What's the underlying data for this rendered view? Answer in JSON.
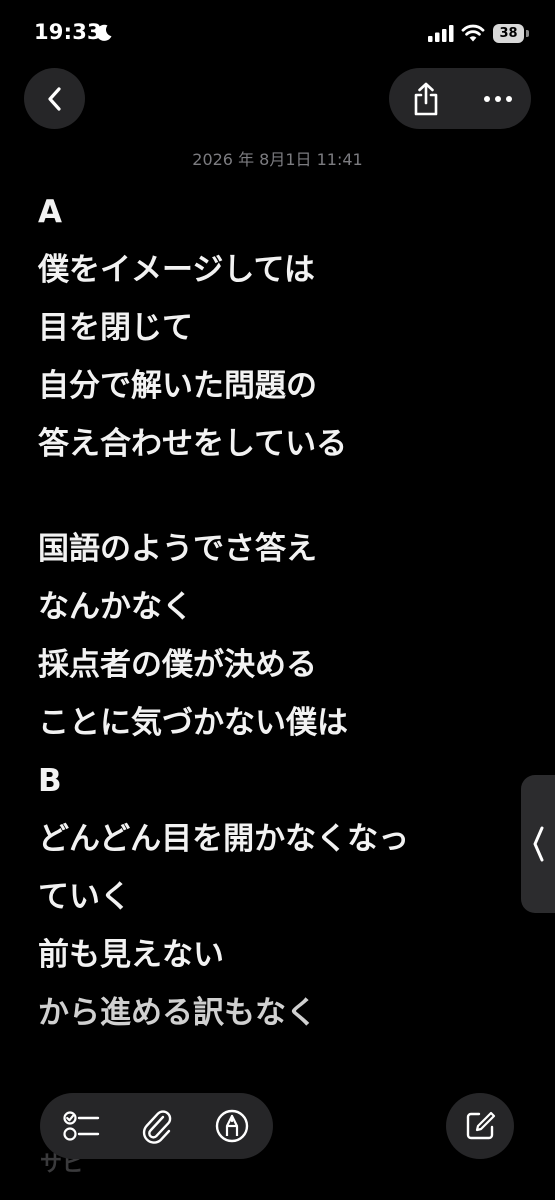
{
  "status_bar": {
    "time": "19:33",
    "battery_level": "38",
    "icons": [
      "moon-icon",
      "signal-icon",
      "wifi-icon",
      "battery-icon"
    ]
  },
  "nav": {
    "back_icon": "chevron-left-icon",
    "share_icon": "share-icon",
    "more_icon": "ellipsis-icon"
  },
  "note": {
    "date": "2026 年 8月1日 11:41",
    "lines": [
      "A",
      "僕をイメージしては",
      "目を閉じて",
      "自分で解いた問題の",
      "答え合わせをしている",
      "",
      "国語のようでさ答え",
      "なんかなく",
      "採点者の僕が決める",
      "ことに気づかない僕は",
      "B",
      "どんどん目を開かなくなっ",
      "ていく",
      "前も見えない",
      "から進める訳もなく"
    ],
    "tail": "サビ"
  },
  "toolbar": {
    "icons": [
      "checklist-icon",
      "paperclip-icon",
      "markup-pen-icon",
      "compose-icon"
    ]
  },
  "colors": {
    "background": "#000000",
    "button_bg": "#262628",
    "text": "#f2f2f2",
    "date_text": "#7c7c80"
  }
}
